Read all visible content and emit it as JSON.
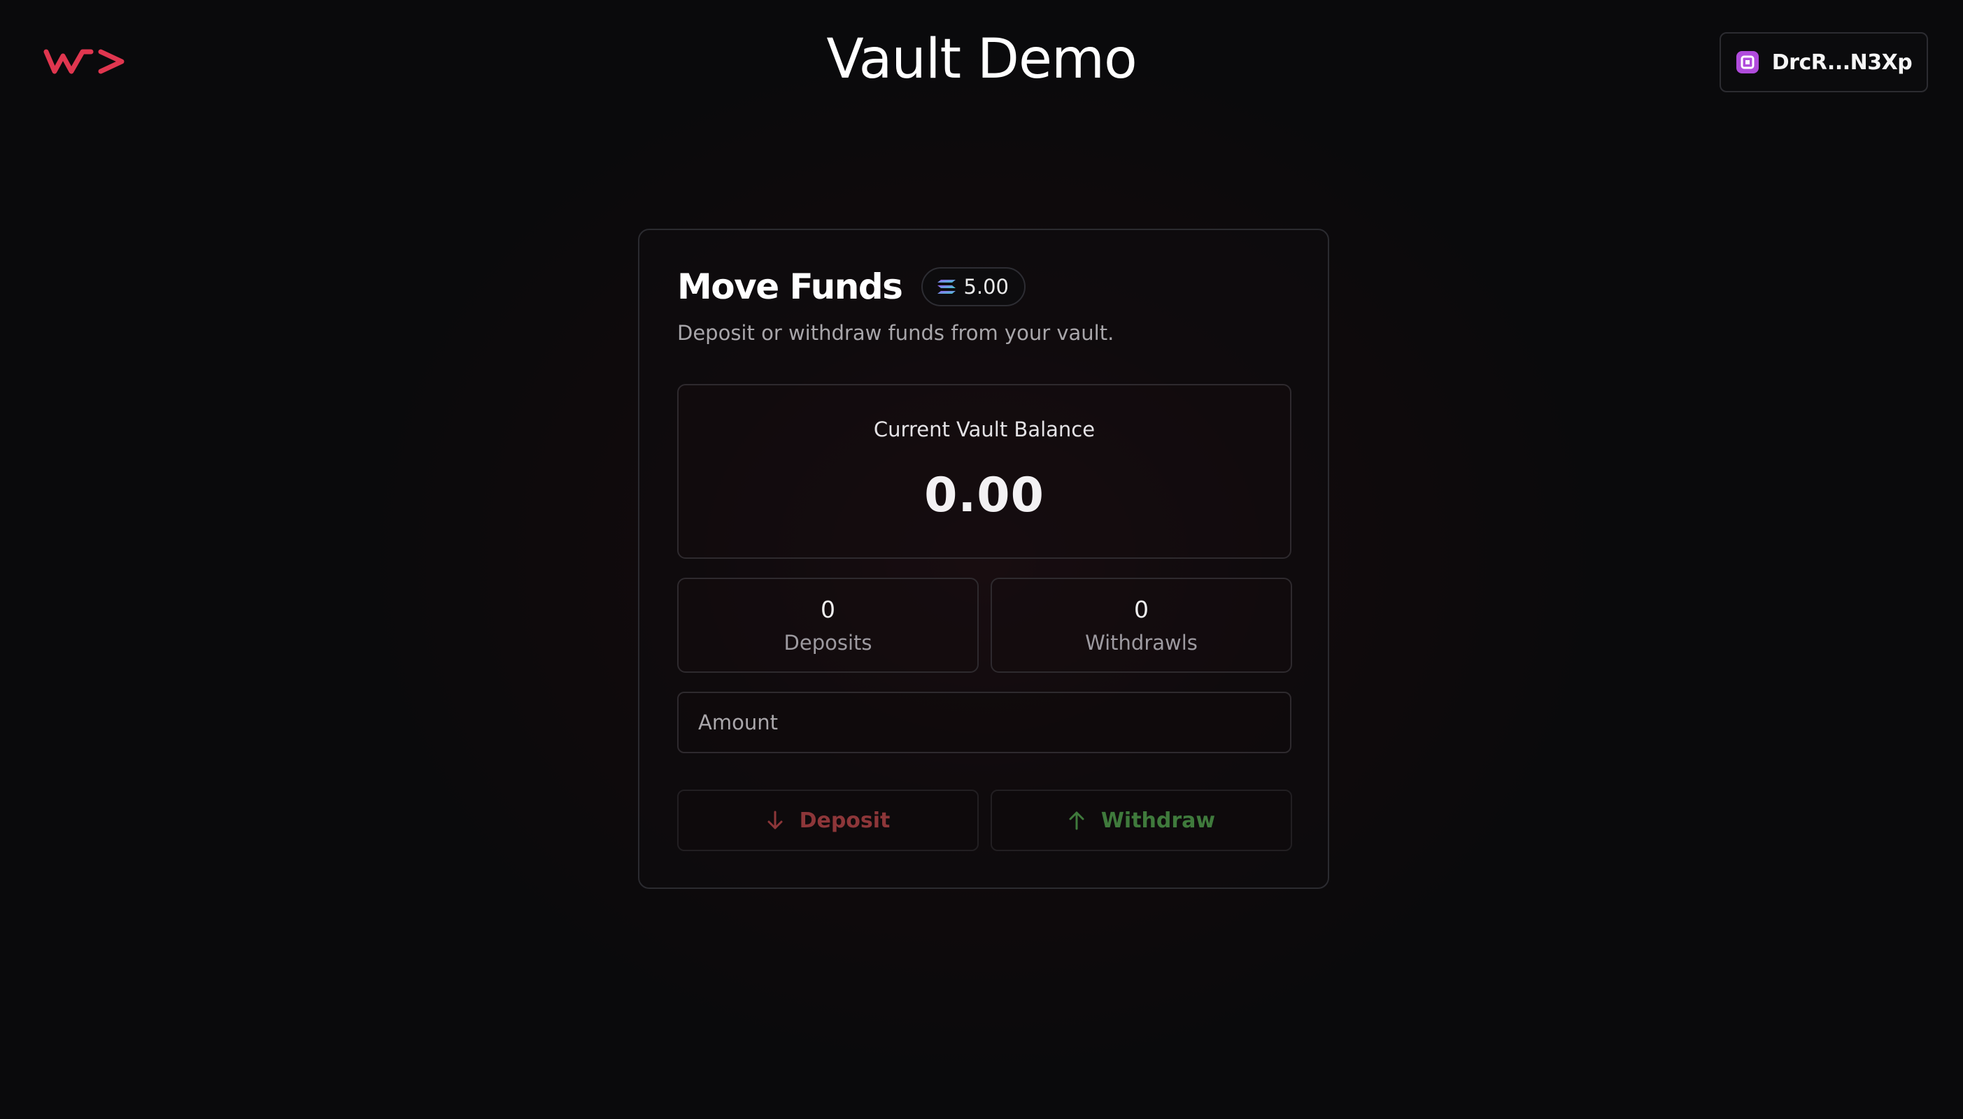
{
  "header": {
    "logo_icon": "brand-logo-icon",
    "title": "Vault Demo",
    "wallet": {
      "icon": "wallet-icon",
      "label": "DrcR...N3Xp"
    }
  },
  "card": {
    "title": "Move Funds",
    "badge": {
      "icon": "solana-icon",
      "value": "5.00"
    },
    "description": "Deposit or withdraw funds from your vault.",
    "vault_balance": {
      "label": "Current Vault Balance",
      "value": "0.00"
    },
    "stats": {
      "deposits": {
        "count": "0",
        "label": "Deposits"
      },
      "withdrawls": {
        "count": "0",
        "label": "Withdrawls"
      }
    },
    "amount_input": {
      "placeholder": "Amount",
      "value": ""
    },
    "buttons": {
      "deposit": {
        "label": "Deposit",
        "icon": "arrow-down-icon"
      },
      "withdraw": {
        "label": "Withdraw",
        "icon": "arrow-up-icon"
      }
    }
  },
  "colors": {
    "brand_accent": "#e0364f",
    "deposit_text": "#8d3639",
    "withdraw_text": "#3f7a3c",
    "wallet_icon": "#b04bdc"
  }
}
